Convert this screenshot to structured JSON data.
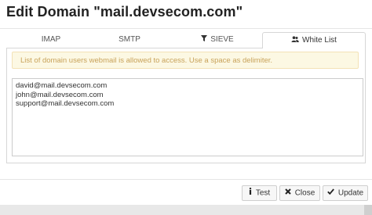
{
  "dialog": {
    "title": "Edit Domain \"mail.devsecom.com\"",
    "close_icon": "close-icon"
  },
  "tabs": [
    {
      "label": "IMAP",
      "icon": "",
      "active": false
    },
    {
      "label": "SMTP",
      "icon": "",
      "active": false
    },
    {
      "label": "SIEVE",
      "icon": "filter-icon",
      "active": false
    },
    {
      "label": "White List",
      "icon": "users-icon",
      "active": true
    }
  ],
  "white_list": {
    "notice": "List of domain users webmail is allowed to access. Use a space as delimiter.",
    "entries": [
      "david@mail.devsecom.com",
      "john@mail.devsecom.com",
      "support@mail.devsecom.com"
    ]
  },
  "footer": {
    "test_label": "Test",
    "close_label": "Close",
    "update_label": "Update"
  },
  "colors": {
    "alert_bg": "#fcf8e3",
    "alert_text": "#c8a25a"
  }
}
